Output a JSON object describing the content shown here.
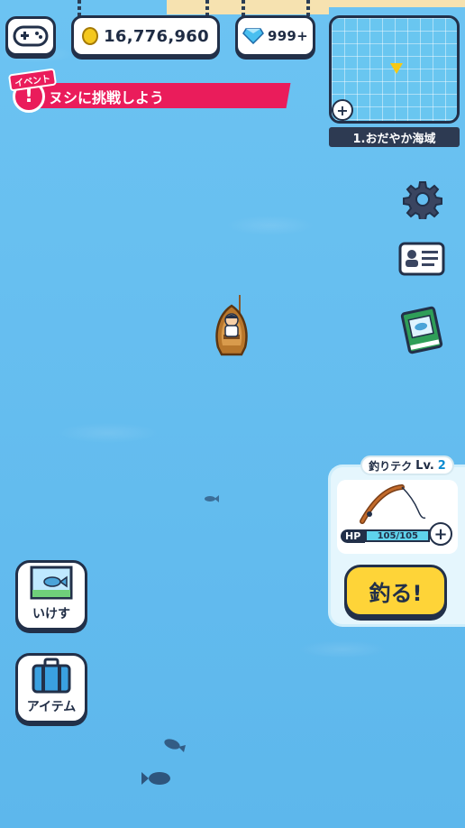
{
  "hud": {
    "coins": "16,776,960",
    "gems": "999+"
  },
  "event": {
    "tag": "イベント",
    "badge": "!",
    "text": "ヌシに挑戦しよう"
  },
  "minimap": {
    "zoom_label": "+",
    "area_name": "1.おだやか海域"
  },
  "fishing": {
    "tech_label": "釣りテク",
    "lv_label": "Lv.",
    "level": "2",
    "hp_label": "HP",
    "hp_value": "105/105",
    "hp_fraction": 1.0,
    "hp_plus": "+",
    "cast_label": "釣る!"
  },
  "buttons": {
    "ikesu_label": "いけす",
    "item_label": "アイテム"
  },
  "colors": {
    "sea": "#63bdf0",
    "event": "#ea1c5b",
    "cast": "#fed438",
    "outline": "#223049"
  },
  "icons": [
    "controller-icon",
    "coin-icon",
    "gem-icon",
    "gear-icon",
    "profile-card-icon",
    "fish-book-icon",
    "fish-tank-icon",
    "suitcase-icon",
    "fishing-rod-icon"
  ]
}
